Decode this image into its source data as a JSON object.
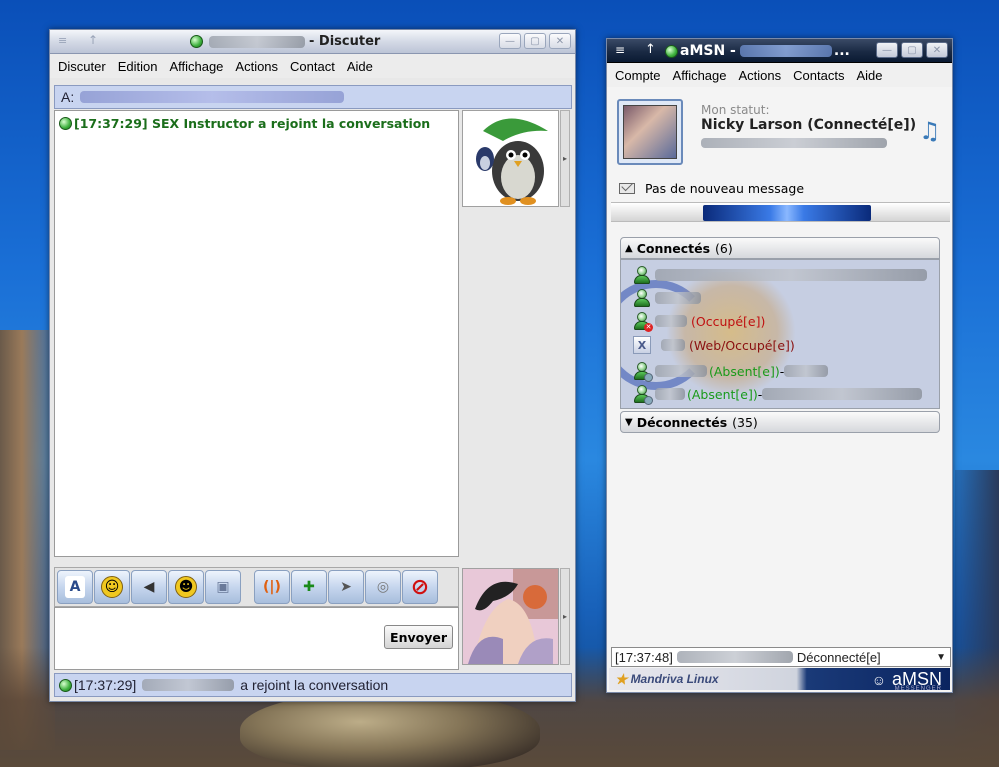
{
  "chat_window": {
    "title_suffix": "- Discuter",
    "menu": [
      "Discuter",
      "Edition",
      "Affichage",
      "Actions",
      "Contact",
      "Aide"
    ],
    "to_label": "A:",
    "messages": [
      {
        "time": "[17:37:29]",
        "text": "SEX Instructor a rejoint la conversation"
      }
    ],
    "send_label": "Envoyer",
    "status": {
      "time": "[17:37:29]",
      "text": "a rejoint la conversation"
    },
    "toolbar_icons": [
      "font-icon",
      "smiley-icon",
      "voice-clip-icon",
      "wink-icon",
      "webcam-icon",
      "nudge-icon",
      "invite-contact-icon",
      "send-file-icon",
      "webcam-share-icon",
      "block-icon"
    ]
  },
  "amsn_window": {
    "title_prefix": "aMSN -",
    "title_suffix": "...",
    "menu": [
      "Compte",
      "Affichage",
      "Actions",
      "Contacts",
      "Aide"
    ],
    "status_label": "Mon statut:",
    "nick": "Nicky Larson (Connecté[e])",
    "mail": "Pas de nouveau message",
    "groups": {
      "online": {
        "name": "Connectés",
        "count": "(6)"
      },
      "offline": {
        "name": "Déconnectés",
        "count": "(35)"
      }
    },
    "contacts": [
      {
        "state": "",
        "note": ""
      },
      {
        "state": "",
        "note": ""
      },
      {
        "state": "(Occupé[e])",
        "note": ""
      },
      {
        "state": "(Web/Occupé[e])",
        "note": ""
      },
      {
        "state": "(Absent[e])",
        "note": " - "
      },
      {
        "state": "(Absent[e])",
        "note": " - "
      }
    ],
    "status_bar": {
      "time": "[17:37:48]",
      "text": "Déconnecté[e]"
    },
    "footer": {
      "left": "Mandriva Linux",
      "right": "aMSN",
      "tag": "MESSENGER"
    }
  }
}
